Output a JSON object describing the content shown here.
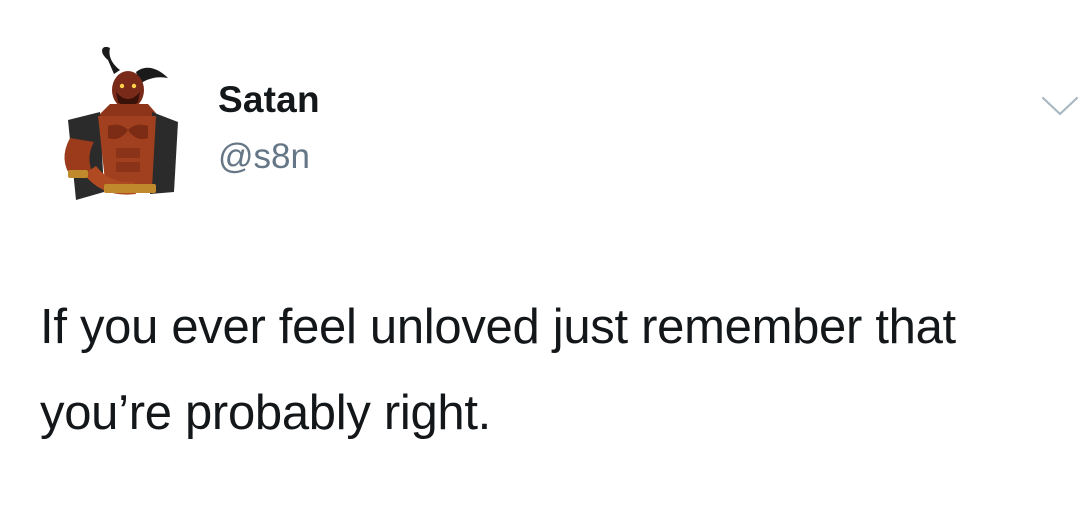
{
  "tweet": {
    "author": {
      "display_name": "Satan",
      "handle": "@s8n",
      "avatar_icon": "demon-avatar"
    },
    "text": "If you ever feel unloved just remember that you’re probably right.",
    "menu_icon": "chevron-down-icon"
  },
  "colors": {
    "text": "#14171a",
    "handle": "#657786",
    "chevron": "#aab8c2",
    "background": "#ffffff"
  }
}
